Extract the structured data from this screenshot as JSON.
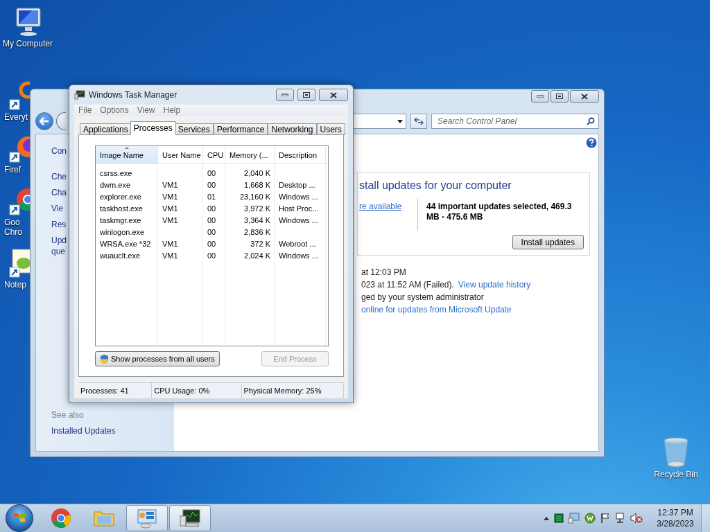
{
  "desktop_icons": [
    {
      "kind": "computer",
      "lines": [
        "My Computer"
      ]
    },
    {
      "kind": "search",
      "lines": [
        "Everyt"
      ]
    },
    {
      "kind": "firefox",
      "lines": [
        "Firef"
      ]
    },
    {
      "kind": "chrome",
      "lines": [
        "Goo",
        "Chro"
      ]
    },
    {
      "kind": "notepad",
      "lines": [
        "Notep"
      ]
    },
    {
      "kind": "recycle-bin",
      "lines": [
        "Recycle Bin"
      ]
    }
  ],
  "control_panel": {
    "search": {
      "placeholder": "Search Control Panel"
    },
    "sidebar": {
      "heading": "Con",
      "items": [
        {
          "lines": [
            "Che"
          ]
        },
        {
          "lines": [
            "Cha"
          ]
        },
        {
          "lines": [
            "Vie"
          ]
        },
        {
          "lines": [
            "Res"
          ]
        },
        {
          "lines": [
            "Upd",
            "que"
          ]
        }
      ]
    },
    "see_also": {
      "title": "See also",
      "links": [
        "Installed Updates"
      ]
    },
    "update_panel": {
      "heading": "stall updates for your computer",
      "link": "re available",
      "summary": "44 important updates selected, 469.3 MB - 475.6 MB",
      "button": "Install updates"
    },
    "status_lines": [
      {
        "text": "at 12:03 PM"
      },
      {
        "text": "023 at 11:52 AM (Failed).",
        "link": "View update history"
      },
      {
        "text": "ged by your system administrator"
      },
      {
        "link": "online for updates from Microsoft Update"
      }
    ]
  },
  "task_manager": {
    "title": "Windows Task Manager",
    "menu": [
      "File",
      "Options",
      "View",
      "Help"
    ],
    "tabs": [
      {
        "label": "Applications",
        "selected": false
      },
      {
        "label": "Processes",
        "selected": true
      },
      {
        "label": "Services",
        "selected": false
      },
      {
        "label": "Performance",
        "selected": false
      },
      {
        "label": "Networking",
        "selected": false
      },
      {
        "label": "Users",
        "selected": false
      }
    ],
    "columns": [
      {
        "label": "Image Name",
        "sorted": true
      },
      {
        "label": "User Name",
        "sorted": false
      },
      {
        "label": "CPU",
        "sorted": false
      },
      {
        "label": "Memory (...",
        "sorted": false
      },
      {
        "label": "Description",
        "sorted": false
      }
    ],
    "rows": [
      [
        "csrss.exe",
        "",
        "00",
        "2,040 K",
        ""
      ],
      [
        "dwm.exe",
        "VM1",
        "00",
        "1,668 K",
        "Desktop ..."
      ],
      [
        "explorer.exe",
        "VM1",
        "01",
        "23,160 K",
        "Windows ..."
      ],
      [
        "taskhost.exe",
        "VM1",
        "00",
        "3,972 K",
        "Host Proc..."
      ],
      [
        "taskmgr.exe",
        "VM1",
        "00",
        "3,364 K",
        "Windows ..."
      ],
      [
        "winlogon.exe",
        "",
        "00",
        "2,836 K",
        ""
      ],
      [
        "WRSA.exe *32",
        "VM1",
        "00",
        "372 K",
        "Webroot ..."
      ],
      [
        "wuauclt.exe",
        "VM1",
        "00",
        "2,024 K",
        "Windows ..."
      ]
    ],
    "buttons": [
      {
        "label": "Show processes from all users",
        "kind": "shield",
        "disabled": false
      },
      {
        "label": "End Process",
        "kind": "plain",
        "disabled": true
      }
    ],
    "status_bar": [
      "Processes: 41",
      "CPU Usage: 0%",
      "Physical Memory: 25%"
    ]
  },
  "taskbar": {
    "apps": [
      {
        "kind": "browser",
        "running": false
      },
      {
        "kind": "folder",
        "running": false
      },
      {
        "kind": "control-panel",
        "running": true
      },
      {
        "kind": "task-manager",
        "running": true
      }
    ],
    "tray": [
      {
        "kind": "up-arrow"
      },
      {
        "kind": "meter"
      },
      {
        "kind": "monitor"
      },
      {
        "kind": "webroot"
      },
      {
        "kind": "flag"
      },
      {
        "kind": "network"
      },
      {
        "kind": "volume-muted"
      }
    ],
    "time": "12:37 PM",
    "date": "3/28/2023"
  }
}
